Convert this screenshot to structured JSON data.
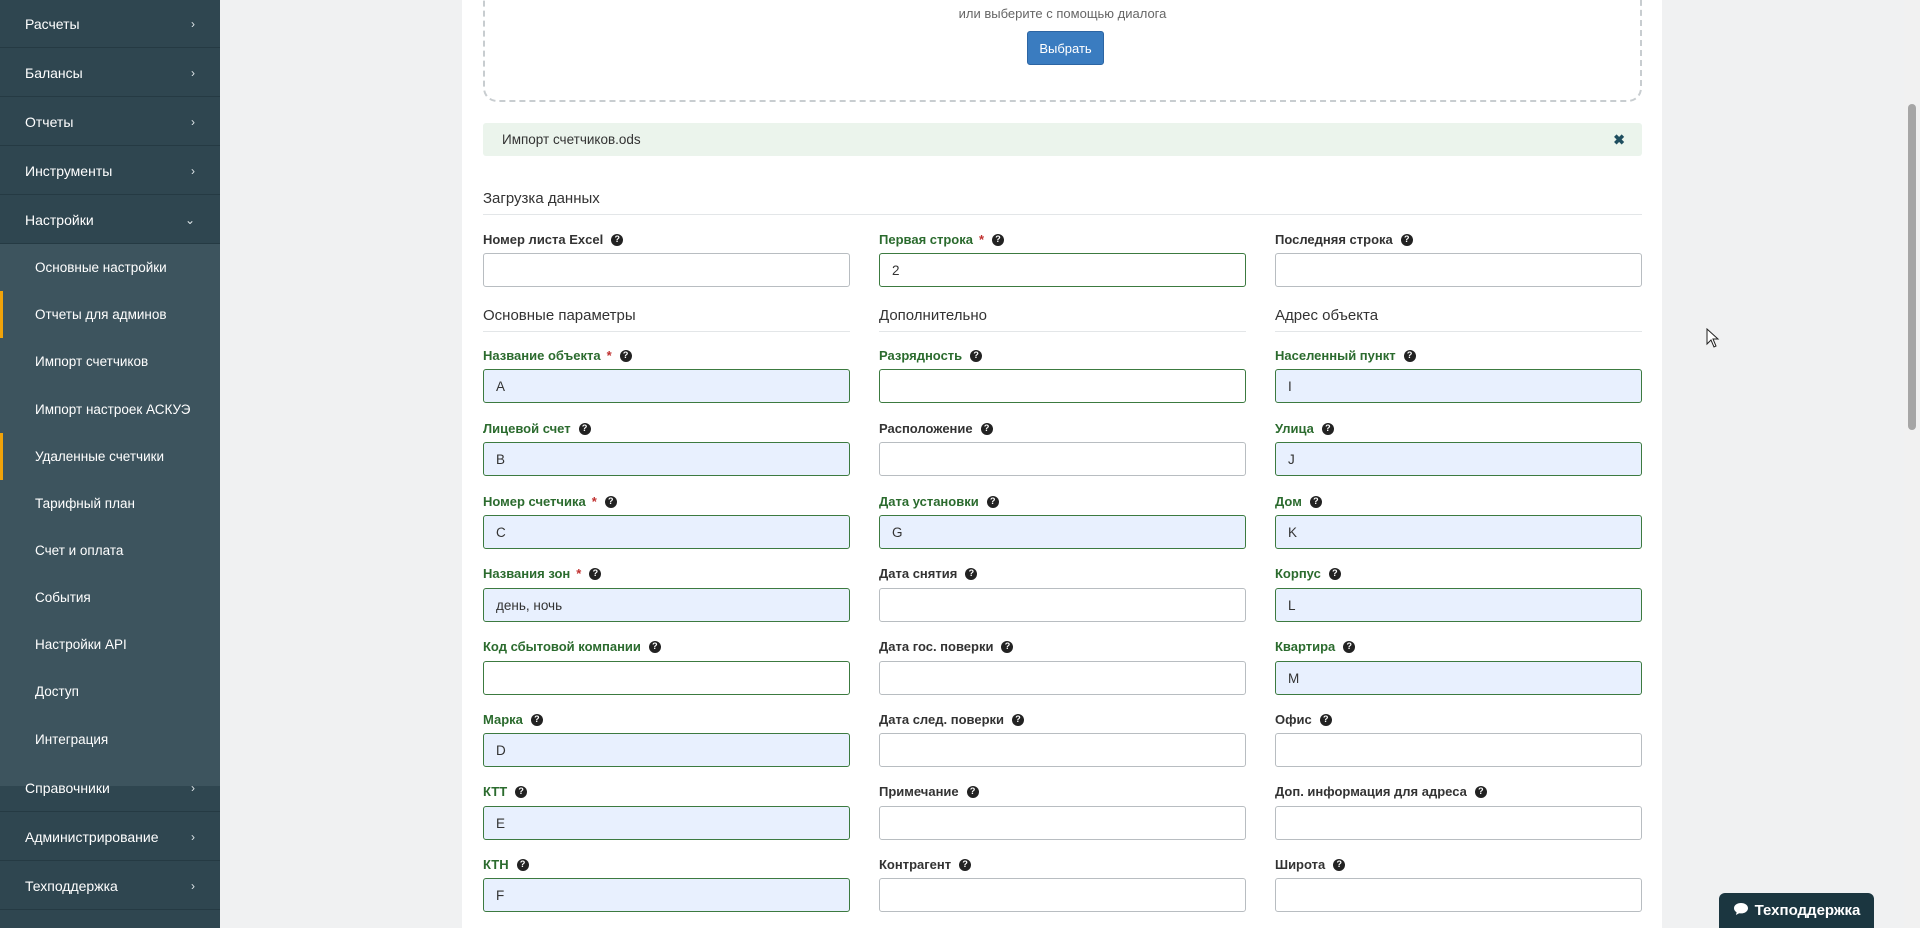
{
  "sidebar": {
    "items": [
      {
        "label": "Расчеты"
      },
      {
        "label": "Балансы"
      },
      {
        "label": "Отчеты"
      },
      {
        "label": "Инструменты"
      },
      {
        "label": "Настройки"
      },
      {
        "label": "Справочники"
      },
      {
        "label": "Администрирование"
      },
      {
        "label": "Техподдержка"
      }
    ],
    "submenu": [
      {
        "label": "Основные настройки"
      },
      {
        "label": "Отчеты для админов"
      },
      {
        "label": "Импорт счетчиков"
      },
      {
        "label": "Импорт настроек АСКУЭ"
      },
      {
        "label": "Удаленные счетчики"
      },
      {
        "label": "Тарифный план"
      },
      {
        "label": "Счет и оплата"
      },
      {
        "label": "События"
      },
      {
        "label": "Настройки API"
      },
      {
        "label": "Доступ"
      },
      {
        "label": "Интеграция"
      }
    ]
  },
  "upload": {
    "hint": "или выберите с помощью диалога",
    "button": "Выбрать",
    "file_name": "Импорт счетчиков.ods",
    "close_glyph": "✖"
  },
  "sections": {
    "load": "Загрузка данных",
    "main": "Основные параметры",
    "extra": "Дополнительно",
    "address": "Адрес объекта"
  },
  "fields": {
    "sheet": {
      "label": "Номер листа Excel",
      "value": ""
    },
    "first_row": {
      "label": "Первая строка",
      "value": "2"
    },
    "last_row": {
      "label": "Последняя строка",
      "value": ""
    },
    "object_name": {
      "label": "Название объекта",
      "value": "A"
    },
    "account": {
      "label": "Лицевой счет",
      "value": "B"
    },
    "meter_number": {
      "label": "Номер счетчика",
      "value": "C"
    },
    "zones": {
      "label": "Названия зон",
      "value": "день, ночь"
    },
    "supplier_code": {
      "label": "Код сбытовой компании",
      "value": ""
    },
    "brand": {
      "label": "Марка",
      "value": "D"
    },
    "ktt": {
      "label": "КТТ",
      "value": "E"
    },
    "ktn": {
      "label": "КТН",
      "value": "F"
    },
    "digits": {
      "label": "Разрядность",
      "value": ""
    },
    "location": {
      "label": "Расположение",
      "value": ""
    },
    "install_date": {
      "label": "Дата установки",
      "value": "G"
    },
    "removal_date": {
      "label": "Дата снятия",
      "value": ""
    },
    "verify_date": {
      "label": "Дата гос. поверки",
      "value": ""
    },
    "next_verify": {
      "label": "Дата след. поверки",
      "value": ""
    },
    "note": {
      "label": "Примечание",
      "value": ""
    },
    "counterparty": {
      "label": "Контрагент",
      "value": ""
    },
    "locality": {
      "label": "Населенный пункт",
      "value": "I"
    },
    "street": {
      "label": "Улица",
      "value": "J"
    },
    "house": {
      "label": "Дом",
      "value": "K"
    },
    "building": {
      "label": "Корпус",
      "value": "L"
    },
    "apartment": {
      "label": "Квартира",
      "value": "M"
    },
    "office": {
      "label": "Офис",
      "value": ""
    },
    "addr_info": {
      "label": "Доп. информация для адреса",
      "value": ""
    },
    "latitude": {
      "label": "Широта",
      "value": ""
    }
  },
  "required_mark": "*",
  "help_glyph": "?",
  "support_button": "Техподдержка",
  "colors": {
    "sidebar_bg": "#2f4650",
    "submenu_bg": "#3d545e",
    "accent_marker": "#f0a30a",
    "primary_button": "#3a7cc0",
    "label_green": "#2b6b2e",
    "required_red": "#c0302f",
    "autofill_bg": "#e8f0fe",
    "file_bar_bg": "#ebf4ec"
  }
}
